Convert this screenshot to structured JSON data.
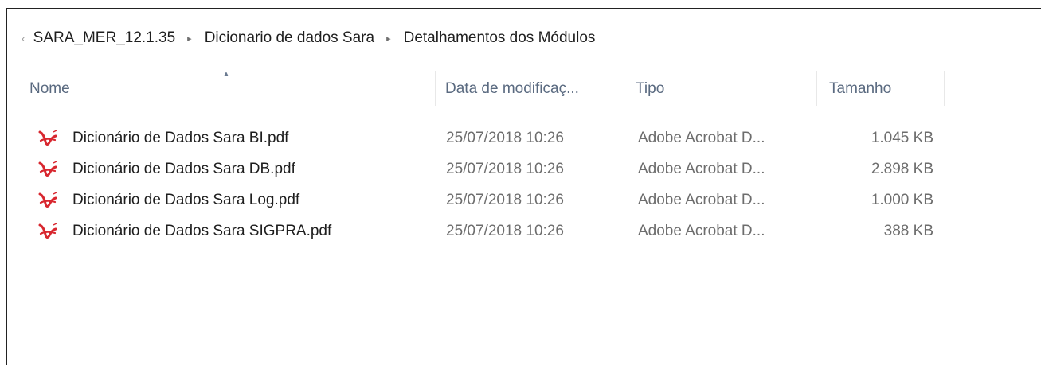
{
  "breadcrumb": {
    "items": [
      "SARA_MER_12.1.35",
      "Dicionario de dados Sara",
      "Detalhamentos dos Módulos"
    ],
    "separator": "▸"
  },
  "columns": {
    "name": "Nome",
    "date": "Data de modificaç...",
    "type": "Tipo",
    "size": "Tamanho"
  },
  "files": [
    {
      "name": "Dicionário de Dados Sara BI.pdf",
      "date": "25/07/2018 10:26",
      "type": "Adobe Acrobat D...",
      "size": "1.045 KB",
      "icon": "pdf-file-icon"
    },
    {
      "name": "Dicionário de Dados Sara DB.pdf",
      "date": "25/07/2018 10:26",
      "type": "Adobe Acrobat D...",
      "size": "2.898 KB",
      "icon": "pdf-file-icon"
    },
    {
      "name": "Dicionário de Dados Sara Log.pdf",
      "date": "25/07/2018 10:26",
      "type": "Adobe Acrobat D...",
      "size": "1.000 KB",
      "icon": "pdf-file-icon"
    },
    {
      "name": "Dicionário de Dados Sara SIGPRA.pdf",
      "date": "25/07/2018 10:26",
      "type": "Adobe Acrobat D...",
      "size": "388 KB",
      "icon": "pdf-file-icon"
    }
  ],
  "colors": {
    "header_text": "#5a6a80",
    "pdf_red": "#d8272f"
  }
}
